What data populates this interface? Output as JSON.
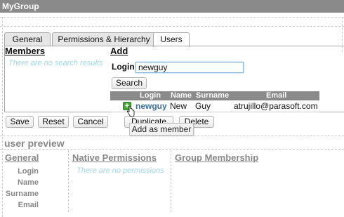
{
  "window": {
    "title": "MyGroup"
  },
  "tabs": [
    {
      "label": "General"
    },
    {
      "label": "Permissions & Hierarchy"
    },
    {
      "label": "Users"
    }
  ],
  "members": {
    "heading": "Members",
    "empty_text": "There are no search results"
  },
  "add": {
    "heading": "Add",
    "login_label": "Login",
    "login_value": "newguy",
    "search_label": "Search",
    "columns": [
      "Login",
      "Name",
      "Surname",
      "Email"
    ],
    "rows": [
      {
        "login": "newguy",
        "name": "New",
        "surname": "Guy",
        "email": "atrujillo@parasoft.com",
        "add_icon": "plus-icon"
      }
    ]
  },
  "actions": {
    "save": "Save",
    "reset": "Reset",
    "cancel": "Cancel",
    "duplicate": "Duplicate",
    "delete": "Delete"
  },
  "tooltip": {
    "text": "Add as member"
  },
  "preview": {
    "title": "user preview",
    "general_heading": "General",
    "native_heading": "Native Permissions",
    "native_empty": "There are no permissions",
    "group_heading": "Group Membership",
    "fields": [
      "Login",
      "Name",
      "Surname",
      "Email"
    ]
  }
}
